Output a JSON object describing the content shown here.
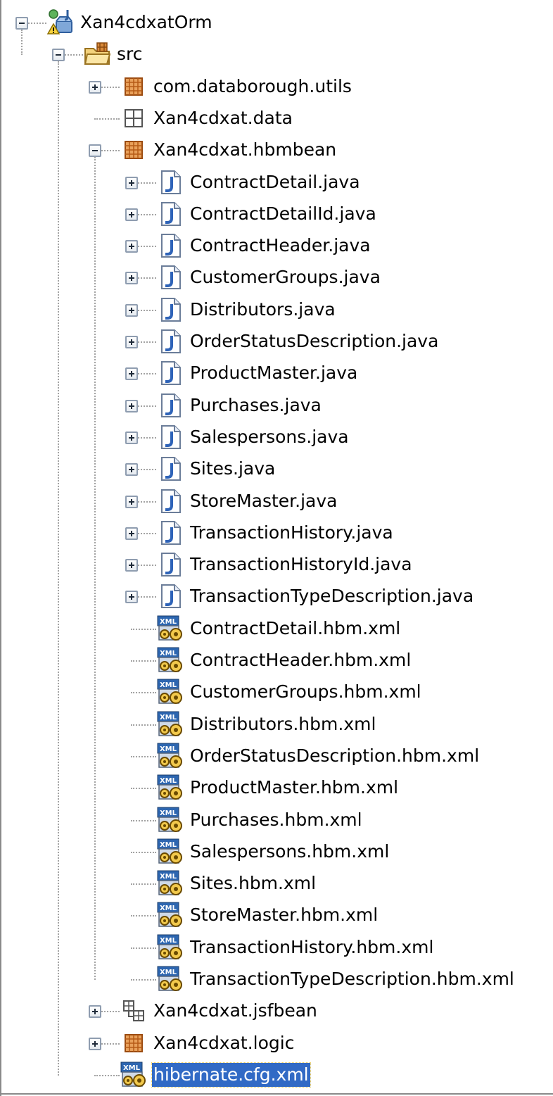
{
  "colors": {
    "selection_bg": "#316ac5",
    "selection_text": "#ffffff",
    "dotted_line": "#a3a3a3"
  },
  "tree": {
    "project": {
      "label": "Xan4cdxatOrm",
      "icon": "java-project-warning-icon",
      "expanded": true
    },
    "src": {
      "label": "src",
      "icon": "source-folder-icon",
      "expanded": true
    },
    "packages_top": [
      {
        "label": "com.databorough.utils",
        "icon": "package-icon",
        "expandable": true,
        "expanded": false
      },
      {
        "label": "Xan4cdxat.data",
        "icon": "empty-package-icon",
        "expandable": false
      }
    ],
    "hbmbean": {
      "label": "Xan4cdxat.hbmbean",
      "icon": "package-icon",
      "expanded": true
    },
    "java_files": [
      {
        "label": "ContractDetail.java",
        "icon": "java-file-icon"
      },
      {
        "label": "ContractDetailId.java",
        "icon": "java-file-icon"
      },
      {
        "label": "ContractHeader.java",
        "icon": "java-file-icon"
      },
      {
        "label": "CustomerGroups.java",
        "icon": "java-file-icon"
      },
      {
        "label": "Distributors.java",
        "icon": "java-file-icon"
      },
      {
        "label": "OrderStatusDescription.java",
        "icon": "java-file-icon"
      },
      {
        "label": "ProductMaster.java",
        "icon": "java-file-icon"
      },
      {
        "label": "Purchases.java",
        "icon": "java-file-icon"
      },
      {
        "label": "Salespersons.java",
        "icon": "java-file-icon"
      },
      {
        "label": "Sites.java",
        "icon": "java-file-icon"
      },
      {
        "label": "StoreMaster.java",
        "icon": "java-file-icon"
      },
      {
        "label": "TransactionHistory.java",
        "icon": "java-file-icon"
      },
      {
        "label": "TransactionHistoryId.java",
        "icon": "java-file-icon"
      },
      {
        "label": "TransactionTypeDescription.java",
        "icon": "java-file-icon"
      }
    ],
    "xml_files": [
      {
        "label": "ContractDetail.hbm.xml",
        "icon": "xml-file-icon"
      },
      {
        "label": "ContractHeader.hbm.xml",
        "icon": "xml-file-icon"
      },
      {
        "label": "CustomerGroups.hbm.xml",
        "icon": "xml-file-icon"
      },
      {
        "label": "Distributors.hbm.xml",
        "icon": "xml-file-icon"
      },
      {
        "label": "OrderStatusDescription.hbm.xml",
        "icon": "xml-file-icon"
      },
      {
        "label": "ProductMaster.hbm.xml",
        "icon": "xml-file-icon"
      },
      {
        "label": "Purchases.hbm.xml",
        "icon": "xml-file-icon"
      },
      {
        "label": "Salespersons.hbm.xml",
        "icon": "xml-file-icon"
      },
      {
        "label": "Sites.hbm.xml",
        "icon": "xml-file-icon"
      },
      {
        "label": "StoreMaster.hbm.xml",
        "icon": "xml-file-icon"
      },
      {
        "label": "TransactionHistory.hbm.xml",
        "icon": "xml-file-icon"
      },
      {
        "label": "TransactionTypeDescription.hbm.xml",
        "icon": "xml-file-icon"
      }
    ],
    "packages_bottom": [
      {
        "label": "Xan4cdxat.jsfbean",
        "icon": "package-hierarchy-icon",
        "expandable": true,
        "expanded": false
      },
      {
        "label": "Xan4cdxat.logic",
        "icon": "package-icon",
        "expandable": true,
        "expanded": false
      }
    ],
    "cfg_file": {
      "label": "hibernate.cfg.xml",
      "icon": "xml-file-icon",
      "selected": true
    }
  }
}
